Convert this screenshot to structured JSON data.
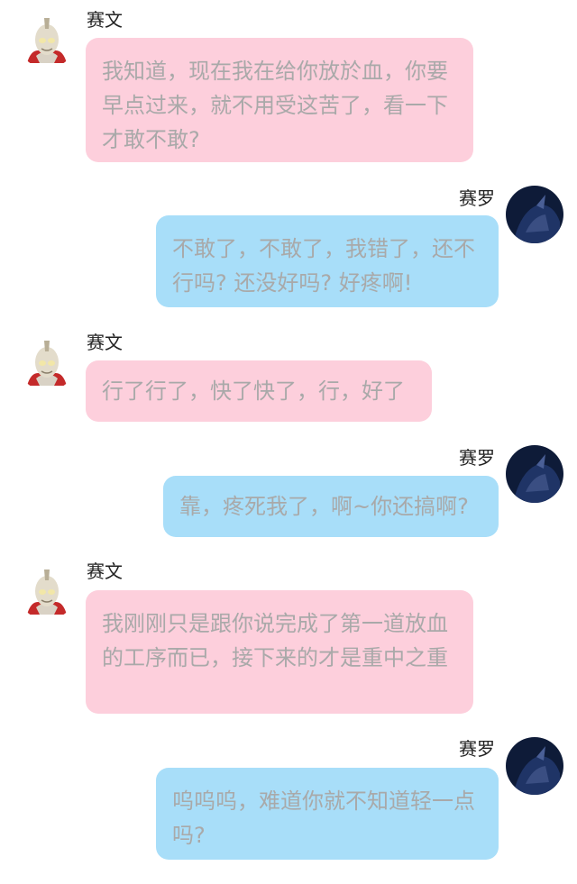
{
  "messages": [
    {
      "sender": "赛文",
      "side": "left",
      "text": "我知道，现在我在给你放於血，你要早点过来，就不用受这苦了，看一下才敢不敢?"
    },
    {
      "sender": "赛罗",
      "side": "right",
      "text": "不敢了，不敢了，我错了，还不行吗? 还没好吗? 好疼啊!"
    },
    {
      "sender": "赛文",
      "side": "left",
      "text": "行了行了，快了快了，行，好了"
    },
    {
      "sender": "赛罗",
      "side": "right",
      "text": "靠，疼死我了，啊~你还搞啊?"
    },
    {
      "sender": "赛文",
      "side": "left",
      "text": "我刚刚只是跟你说完成了第一道放血的工序而已，接下来的才是重中之重"
    },
    {
      "sender": "赛罗",
      "side": "right",
      "text": "呜呜呜，难道你就不知道轻一点吗?"
    }
  ],
  "avatars": {
    "left": "seven-helmet-avatar",
    "right": "zero-dark-avatar"
  },
  "colors": {
    "left_bubble": "#fdcfdc",
    "right_bubble": "#a8def9",
    "bubble_text": "#a9a9a9"
  }
}
